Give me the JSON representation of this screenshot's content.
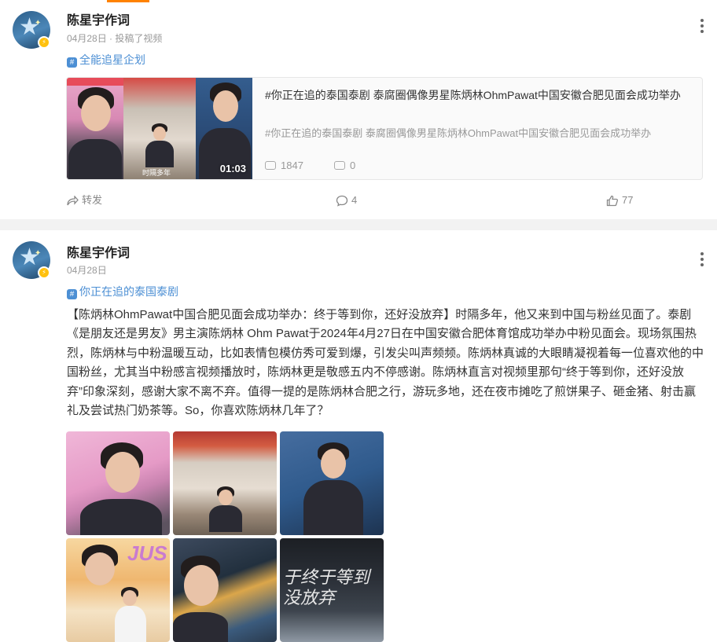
{
  "posts": [
    {
      "author": "陈星宇作词",
      "date": "04月28日",
      "meta_suffix": " · 投稿了视频",
      "topic": "全能追星企划",
      "video": {
        "title": "#你正在追的泰国泰剧 泰腐圈偶像男星陈炳林OhmPawat中国安徽合肥见面会成功举办",
        "description": "#你正在追的泰国泰剧 泰腐圈偶像男星陈炳林OhmPawat中国安徽合肥见面会成功举办",
        "duration": "01:03",
        "thumb_caption": "时隔多年",
        "views": "1847",
        "danmaku": "0"
      },
      "actions": {
        "repost": "转发",
        "comments": "4",
        "likes": "77"
      }
    },
    {
      "author": "陈星宇作词",
      "date": "04月28日",
      "topic": "你正在追的泰国泰剧",
      "text": "【陈炳林OhmPawat中国合肥见面会成功举办：终于等到你，还好没放弃】时隔多年，他又来到中国与粉丝见面了。泰剧《是朋友还是男友》男主演陈炳林 Ohm Pawat于2024年4月27日在中国安徽合肥体育馆成功举办中粉见面会。现场氛围热烈，陈炳林与中粉温暖互动，比如表情包模仿秀可爱到爆，引发尖叫声频频。陈炳林真诚的大眼睛凝视着每一位喜欢他的中国粉丝，尤其当中粉感言视频播放时，陈炳林更是敬感五内不停感谢。陈炳林直言对视频里那句“终于等到你，还好没放弃”印象深刻，感谢大家不离不弃。值得一提的是陈炳林合肥之行，游玩多地，还在夜市摊吃了煎饼果子、砸金猪、射击赢礼及尝试热门奶茶等。So，你喜欢陈炳林几年了？",
      "image_texts": {
        "g4": "JUS",
        "g6": "于终于等到 没放弃"
      }
    }
  ],
  "colors": {
    "accent": "#ff8200",
    "link": "#4c8fd4",
    "topic_hash": "#4c8fd4"
  }
}
